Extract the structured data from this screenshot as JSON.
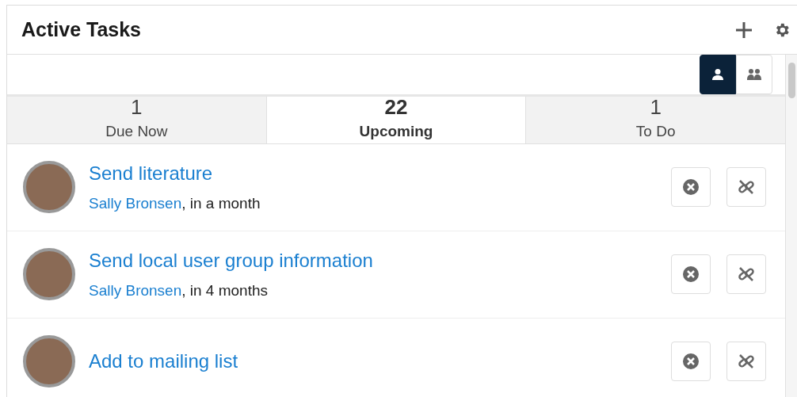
{
  "header": {
    "title": "Active Tasks"
  },
  "view_toggle": [
    {
      "kind": "user",
      "selected": true
    },
    {
      "kind": "group",
      "selected": false
    }
  ],
  "tabs": [
    {
      "count": "1",
      "label": "Due Now",
      "selected": false
    },
    {
      "count": "22",
      "label": "Upcoming",
      "selected": true
    },
    {
      "count": "1",
      "label": "To Do",
      "selected": false
    }
  ],
  "tasks": [
    {
      "title": "Send literature",
      "assignee": "Sally Bronsen",
      "due": ", in a month"
    },
    {
      "title": "Send local user group information",
      "assignee": "Sally Bronsen",
      "due": ", in 4 months"
    },
    {
      "title": "Add to mailing list"
    }
  ]
}
